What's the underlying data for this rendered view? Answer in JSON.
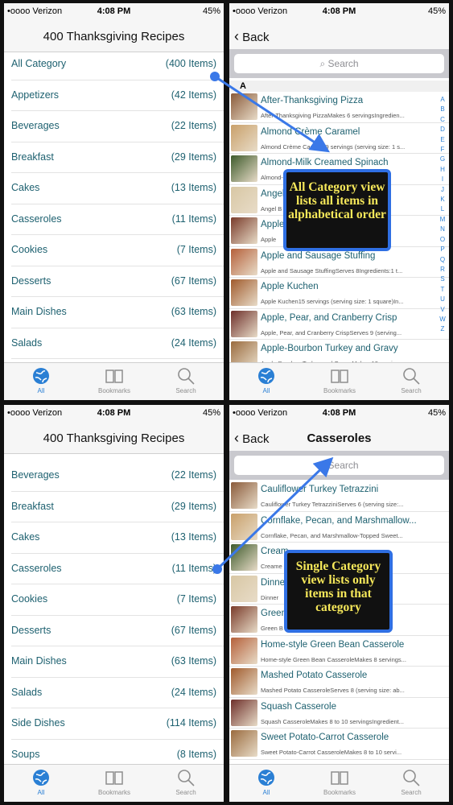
{
  "status": {
    "carrier": "•oooo Verizon",
    "time": "4:08 PM",
    "battery": "45%"
  },
  "app_title": "400 Thanksgiving Recipes",
  "back_label": "Back",
  "search_placeholder": "Search",
  "tabs": [
    {
      "label": "All",
      "icon": "globe-icon"
    },
    {
      "label": "Bookmarks",
      "icon": "book-icon"
    },
    {
      "label": "Search",
      "icon": "magnifier-icon"
    }
  ],
  "screen1": {
    "categories": [
      {
        "name": "All Category",
        "count": "(400 Items)"
      },
      {
        "name": "Appetizers",
        "count": "(42 Items)"
      },
      {
        "name": "Beverages",
        "count": "(22 Items)"
      },
      {
        "name": "Breakfast",
        "count": "(29 Items)"
      },
      {
        "name": "Cakes",
        "count": "(13 Items)"
      },
      {
        "name": "Casseroles",
        "count": "(11 Items)"
      },
      {
        "name": "Cookies",
        "count": "(7 Items)"
      },
      {
        "name": "Desserts",
        "count": "(67 Items)"
      },
      {
        "name": "Main Dishes",
        "count": "(63 Items)"
      },
      {
        "name": "Salads",
        "count": "(24 Items)"
      }
    ]
  },
  "screen2": {
    "section": "A",
    "index_letters": [
      "A",
      "B",
      "C",
      "D",
      "E",
      "F",
      "G",
      "H",
      "I",
      "J",
      "K",
      "L",
      "M",
      "N",
      "O",
      "P",
      "Q",
      "R",
      "S",
      "T",
      "U",
      "V",
      "W",
      "Z"
    ],
    "recipes": [
      {
        "title": "After-Thanksgiving Pizza",
        "desc": "After-Thanksgiving PizzaMakes 6 servingsIngredien..."
      },
      {
        "title": "Almond Crème Caramel",
        "desc": "Almond Crème Caramel9 servings (serving size: 1 s..."
      },
      {
        "title": "Almond-Milk Creamed Spinach",
        "desc": "Almond-Milk Creamed Spinach 20 oun..."
      },
      {
        "title": "Angel",
        "desc": "Angel B"
      },
      {
        "title": "Apple",
        "desc": "Apple"
      },
      {
        "title": "Apple and Sausage Stuffing",
        "desc": "Apple and Sausage StuffingServes 8Ingredients:1 t..."
      },
      {
        "title": "Apple Kuchen",
        "desc": "Apple Kuchen15 servings (serving size: 1 square)In..."
      },
      {
        "title": "Apple, Pear, and Cranberry Crisp",
        "desc": "Apple, Pear, and Cranberry CrispServes 9 (serving..."
      },
      {
        "title": "Apple-Bourbon Turkey and Gravy",
        "desc": "Apple-Bourbon Turkey and Gravy Makes 12 servings..."
      }
    ],
    "callout": "All Category view lists all items in alphabetical order"
  },
  "screen3": {
    "categories": [
      {
        "name": "Beverages",
        "count": "(22 Items)"
      },
      {
        "name": "Breakfast",
        "count": "(29 Items)"
      },
      {
        "name": "Cakes",
        "count": "(13 Items)"
      },
      {
        "name": "Casseroles",
        "count": "(11 Items)"
      },
      {
        "name": "Cookies",
        "count": "(7 Items)"
      },
      {
        "name": "Desserts",
        "count": "(67 Items)"
      },
      {
        "name": "Main Dishes",
        "count": "(63 Items)"
      },
      {
        "name": "Salads",
        "count": "(24 Items)"
      },
      {
        "name": "Side Dishes",
        "count": "(114 Items)"
      },
      {
        "name": "Soups",
        "count": "(8 Items)"
      }
    ]
  },
  "screen4": {
    "title": "Casseroles",
    "recipes": [
      {
        "title": "Cauliflower Turkey Tetrazzini",
        "desc": "Cauliflower Turkey TetrazziniServes 6 (serving size:..."
      },
      {
        "title": "Cornflake, Pecan, and Marshmallow...",
        "desc": "Cornflake, Pecan, and Marshmallow-Topped Sweet..."
      },
      {
        "title": "Cream",
        "desc": "Creame"
      },
      {
        "title": "Dinne",
        "desc": "Dinner"
      },
      {
        "title": "Green",
        "desc": "Green B"
      },
      {
        "title": "Home-style Green Bean Casserole",
        "desc": "Home-style Green Bean CasseroleMakes 8 servings..."
      },
      {
        "title": "Mashed Potato Casserole",
        "desc": "Mashed Potato CasseroleServes 8 (serving size: ab..."
      },
      {
        "title": "Squash Casserole",
        "desc": "Squash CasseroleMakes 8 to 10 servingsIngredient..."
      },
      {
        "title": "Sweet Potato-Carrot Casserole",
        "desc": "Sweet Potato-Carrot CasseroleMakes 8 to 10 servi..."
      }
    ],
    "callout": "Single Category view lists only items in that category"
  },
  "colors": {
    "accent": "#2a7fd4",
    "link_text": "#1e6170",
    "callout_border": "#2f6fe3",
    "callout_text": "#f6e85a"
  }
}
